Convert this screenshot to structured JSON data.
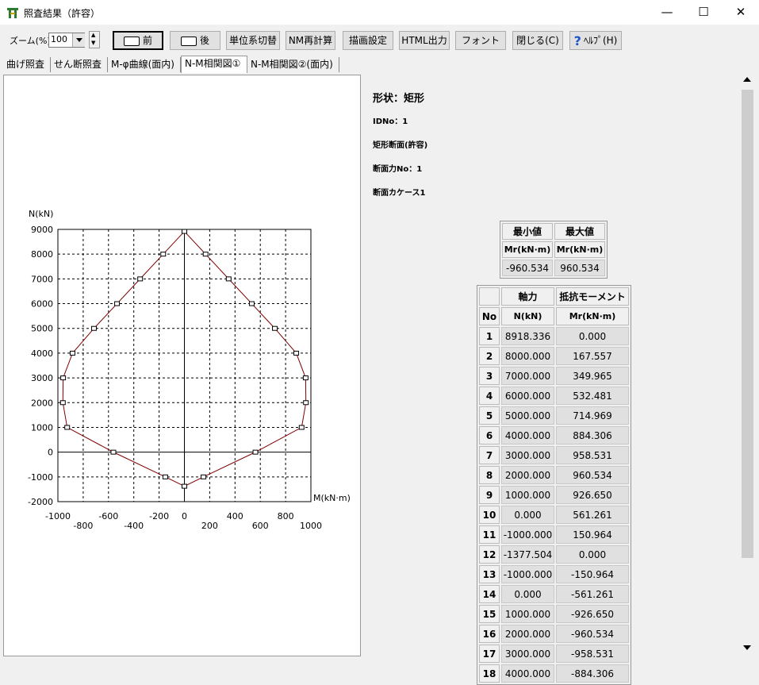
{
  "window": {
    "title": "照査結果（許容）",
    "minimize": "—",
    "maximize": "☐",
    "close": "✕"
  },
  "toolbar": {
    "zoom_label": "ズーム(%)",
    "zoom_value": "100",
    "prev_label": "前",
    "next_label": "後",
    "unit_label": "単位系切替",
    "nm_recalc_label": "NM再計算",
    "draw_settings_label": "描画設定",
    "html_output_label": "HTML出力",
    "font_label": "フォント",
    "close_label": "閉じる(C)",
    "help_label": "ﾍﾙﾌﾟ(H)"
  },
  "tabs": [
    {
      "label": "曲げ照査"
    },
    {
      "label": "せん断照査"
    },
    {
      "label": "M-φ曲線(面内)"
    },
    {
      "label": "N-M相関図①"
    },
    {
      "label": "N-M相関図②(面内)"
    }
  ],
  "info": {
    "shape": "形状：矩形",
    "id_no": "IDNo：1",
    "section": "矩形断面(許容)",
    "force_no": "断面力No：1",
    "force_case": "断面カケース1"
  },
  "minmax": {
    "header_min": "最小値",
    "header_max": "最大値",
    "unit_min": "Mr(kN·m)",
    "unit_max": "Mr(kN·m)",
    "min_value": "-960.534",
    "max_value": "960.534"
  },
  "table": {
    "header_axial": "軸力",
    "header_moment": "抵抗モーメント",
    "header_no": "No",
    "unit_axial": "N(kN)",
    "unit_moment": "Mr(kN·m)",
    "rows": [
      {
        "no": "1",
        "n": "8918.336",
        "m": "0.000"
      },
      {
        "no": "2",
        "n": "8000.000",
        "m": "167.557"
      },
      {
        "no": "3",
        "n": "7000.000",
        "m": "349.965"
      },
      {
        "no": "4",
        "n": "6000.000",
        "m": "532.481"
      },
      {
        "no": "5",
        "n": "5000.000",
        "m": "714.969"
      },
      {
        "no": "6",
        "n": "4000.000",
        "m": "884.306"
      },
      {
        "no": "7",
        "n": "3000.000",
        "m": "958.531"
      },
      {
        "no": "8",
        "n": "2000.000",
        "m": "960.534"
      },
      {
        "no": "9",
        "n": "1000.000",
        "m": "926.650"
      },
      {
        "no": "10",
        "n": "0.000",
        "m": "561.261"
      },
      {
        "no": "11",
        "n": "-1000.000",
        "m": "150.964"
      },
      {
        "no": "12",
        "n": "-1377.504",
        "m": "0.000"
      },
      {
        "no": "13",
        "n": "-1000.000",
        "m": "-150.964"
      },
      {
        "no": "14",
        "n": "0.000",
        "m": "-561.261"
      },
      {
        "no": "15",
        "n": "1000.000",
        "m": "-926.650"
      },
      {
        "no": "16",
        "n": "2000.000",
        "m": "-960.534"
      },
      {
        "no": "17",
        "n": "3000.000",
        "m": "-958.531"
      },
      {
        "no": "18",
        "n": "4000.000",
        "m": "-884.306"
      }
    ]
  },
  "chart_data": {
    "type": "line",
    "title": "",
    "xlabel": "M(kN·m)",
    "ylabel": "N(kN)",
    "xlim": [
      -1000,
      1000
    ],
    "ylim": [
      -2000,
      9000
    ],
    "x_ticks_upper": [
      -1000,
      -600,
      -200,
      0,
      400,
      800
    ],
    "x_ticks_lower": [
      -800,
      -400,
      200,
      600,
      1000
    ],
    "y_ticks": [
      9000,
      8000,
      7000,
      6000,
      5000,
      4000,
      3000,
      2000,
      1000,
      0,
      -1000,
      -2000
    ],
    "grid": true,
    "line_color": "#800000",
    "points": [
      [
        0,
        8918.336
      ],
      [
        167.557,
        8000
      ],
      [
        349.965,
        7000
      ],
      [
        532.481,
        6000
      ],
      [
        714.969,
        5000
      ],
      [
        884.306,
        4000
      ],
      [
        958.531,
        3000
      ],
      [
        960.534,
        2000
      ],
      [
        926.65,
        1000
      ],
      [
        561.261,
        0
      ],
      [
        150.964,
        -1000
      ],
      [
        0,
        -1377.504
      ],
      [
        -150.964,
        -1000
      ],
      [
        -561.261,
        0
      ],
      [
        -926.65,
        1000
      ],
      [
        -960.534,
        2000
      ],
      [
        -958.531,
        3000
      ],
      [
        -884.306,
        4000
      ],
      [
        -714.969,
        5000
      ],
      [
        -532.481,
        6000
      ],
      [
        -349.965,
        7000
      ],
      [
        -167.557,
        8000
      ],
      [
        0,
        8918.336
      ]
    ]
  }
}
